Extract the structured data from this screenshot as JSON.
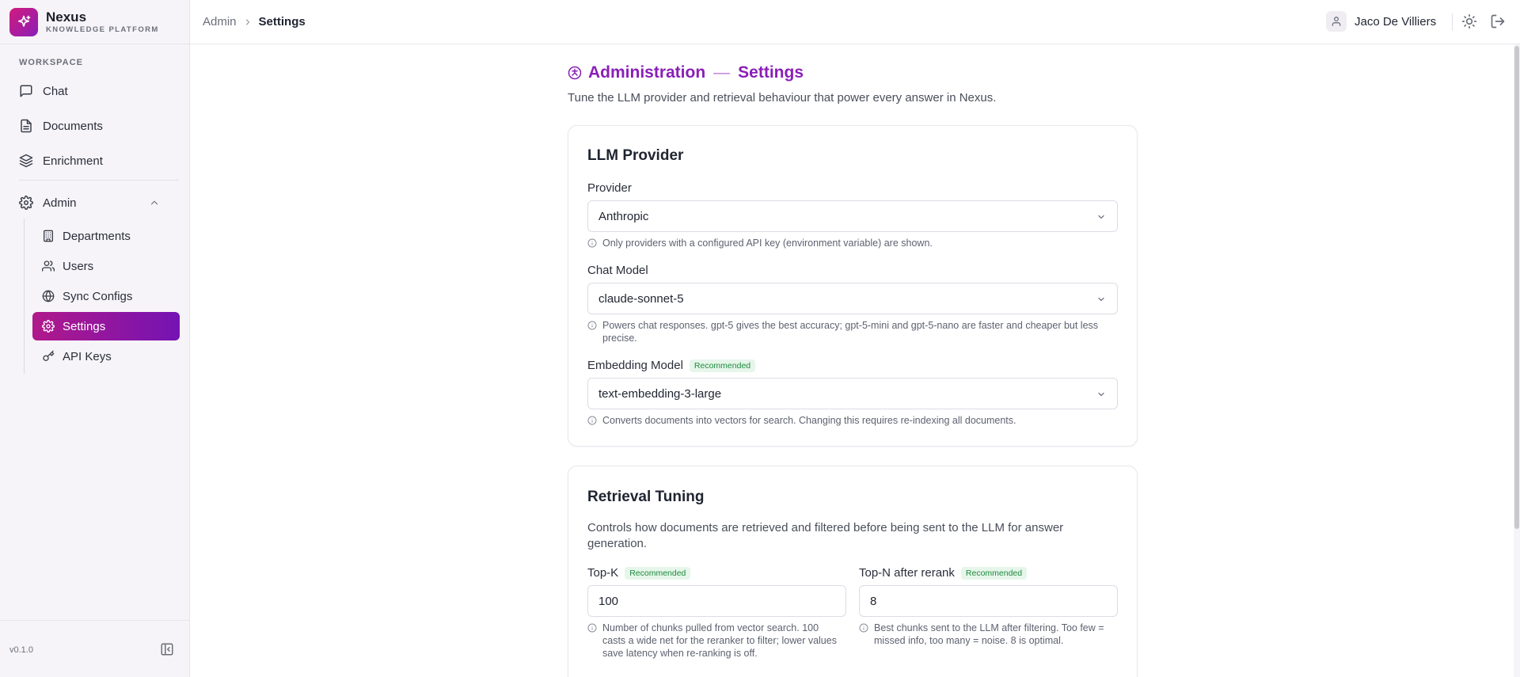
{
  "brand": {
    "name": "Nexus",
    "subtitle": "KNOWLEDGE PLATFORM"
  },
  "sidebar": {
    "section_label": "WORKSPACE",
    "items": [
      {
        "label": "Chat",
        "icon": "chat-bubble-icon"
      },
      {
        "label": "Documents",
        "icon": "document-icon"
      },
      {
        "label": "Enrichment",
        "icon": "layers-icon"
      },
      {
        "label": "Admin",
        "icon": "gear-icon",
        "expanded": true
      }
    ],
    "admin_items": [
      {
        "label": "Departments",
        "icon": "building-icon"
      },
      {
        "label": "Users",
        "icon": "users-icon"
      },
      {
        "label": "Sync Configs",
        "icon": "globe-icon"
      },
      {
        "label": "Settings",
        "icon": "gear-icon",
        "active": true
      },
      {
        "label": "API Keys",
        "icon": "key-icon"
      }
    ],
    "version": "v0.1.0"
  },
  "header": {
    "breadcrumb": [
      "Admin",
      "Settings"
    ],
    "user_name": "Jaco De Villiers"
  },
  "page": {
    "title_part1": "Administration",
    "title_sep": "—",
    "title_part2": "Settings",
    "subtitle": "Tune the LLM provider and retrieval behaviour that power every answer in Nexus."
  },
  "llm": {
    "title": "LLM Provider",
    "provider_label": "Provider",
    "provider_value": "Anthropic",
    "provider_help": "Only providers with a configured API key (environment variable) are shown.",
    "chat_model_label": "Chat Model",
    "chat_model_value": "claude-sonnet-5",
    "chat_model_help": "Powers chat responses. gpt-5 gives the best accuracy; gpt-5-mini and gpt-5-nano are faster and cheaper but less precise.",
    "embedding_label": "Embedding Model",
    "embedding_badge": "Recommended",
    "embedding_value": "text-embedding-3-large",
    "embedding_help": "Converts documents into vectors for search. Changing this requires re-indexing all documents."
  },
  "retrieval": {
    "title": "Retrieval Tuning",
    "description": "Controls how documents are retrieved and filtered before being sent to the LLM for answer generation.",
    "topk_label": "Top-K",
    "topk_badge": "Recommended",
    "topk_value": "100",
    "topk_help": "Number of chunks pulled from vector search. 100 casts a wide net for the reranker to filter; lower values save latency when re-ranking is off.",
    "topn_label": "Top-N after rerank",
    "topn_badge": "Recommended",
    "topn_value": "8",
    "topn_help": "Best chunks sent to the LLM after filtering. Too few = missed info, too many = noise. 8 is optimal."
  },
  "colors": {
    "accent": "#8a1fb8",
    "active_gradient_start": "#b0198a",
    "active_gradient_end": "#7413b3",
    "badge_green": "#1f8a3e"
  }
}
